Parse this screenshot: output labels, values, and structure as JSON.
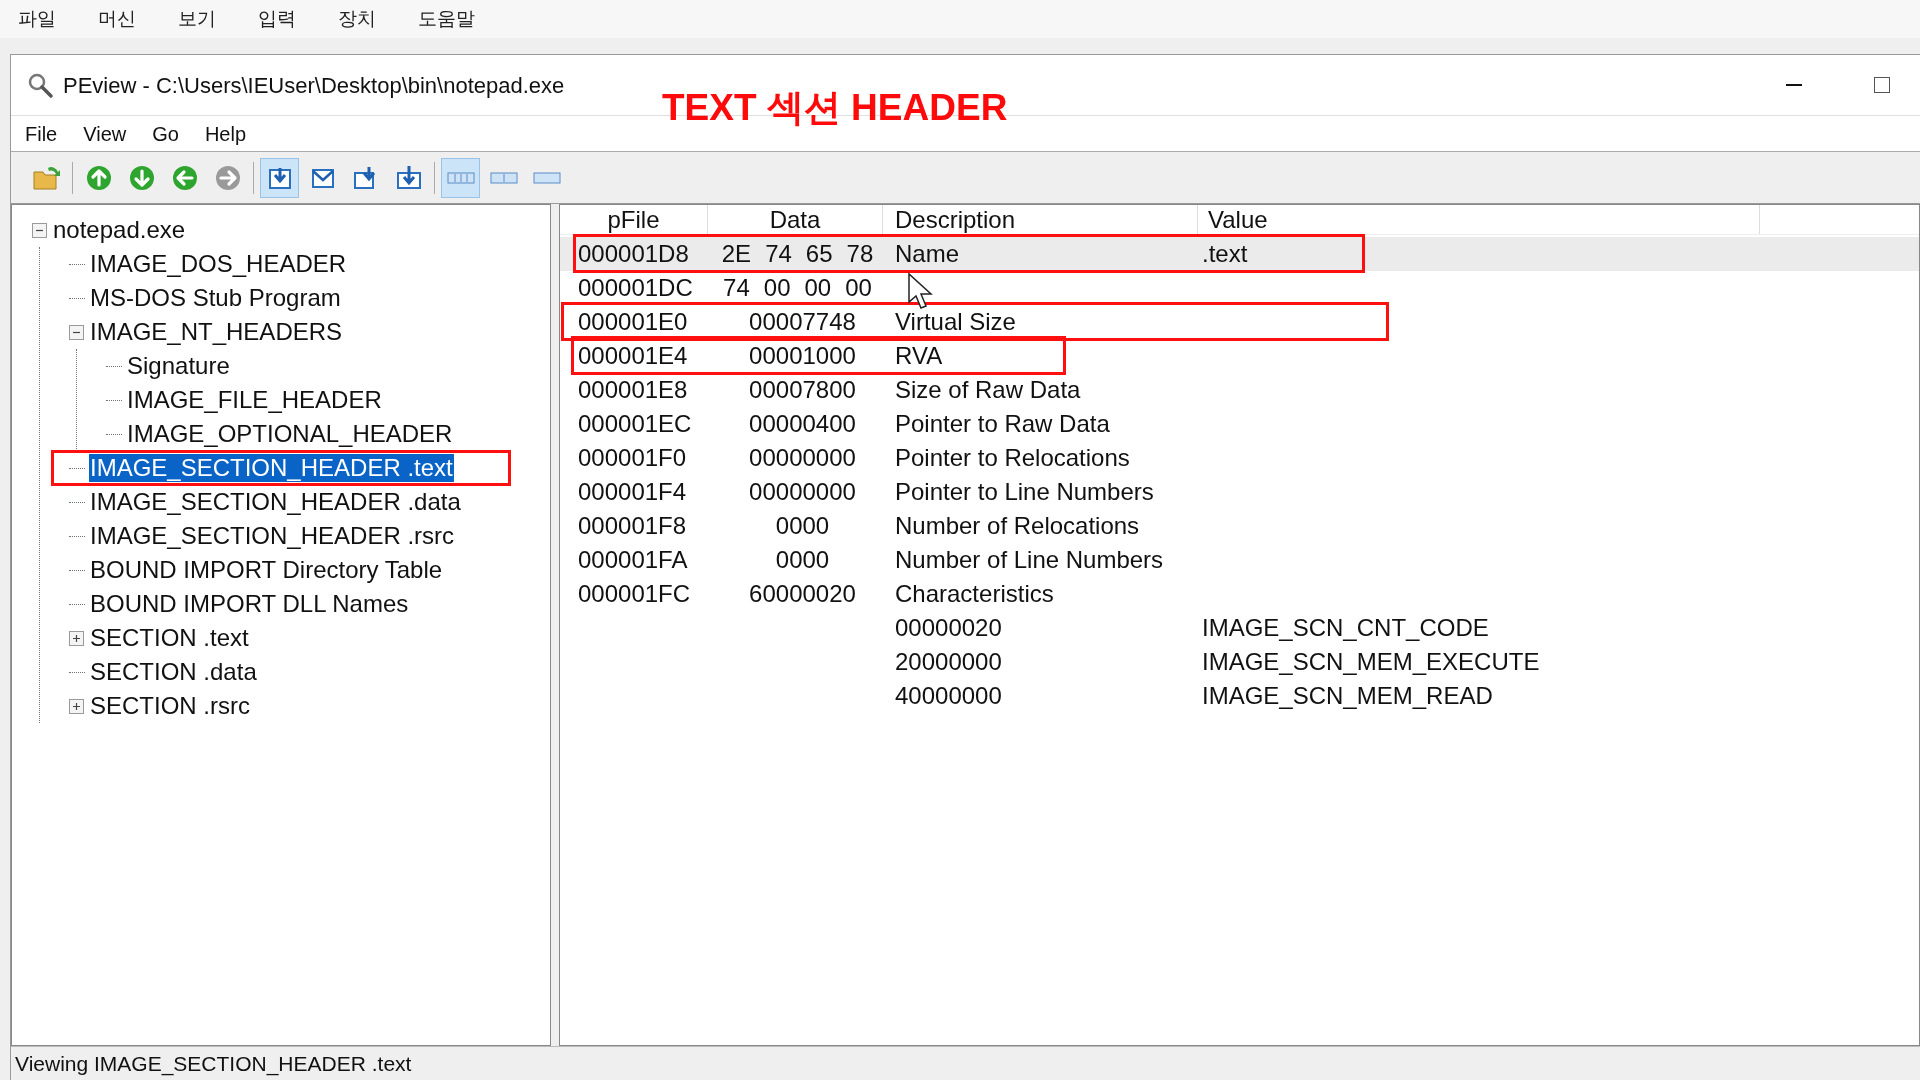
{
  "host_menu": [
    "파일",
    "머신",
    "보기",
    "입력",
    "장치",
    "도움말"
  ],
  "window": {
    "title": "PEview - C:\\Users\\IEUser\\Desktop\\bin\\notepad.exe"
  },
  "annotation": {
    "text": "TEXT 섹션 HEADER"
  },
  "menu": [
    "File",
    "View",
    "Go",
    "Help"
  ],
  "toolbar": [
    [
      {
        "kind": "open",
        "selected": false
      }
    ],
    [
      {
        "kind": "up",
        "disabled": false,
        "selected": false
      },
      {
        "kind": "down",
        "disabled": false,
        "selected": false
      },
      {
        "kind": "back",
        "disabled": false,
        "selected": false
      },
      {
        "kind": "forward",
        "disabled": true,
        "selected": false
      }
    ],
    [
      {
        "kind": "view-a",
        "selected": true
      },
      {
        "kind": "view-b",
        "selected": false
      },
      {
        "kind": "view-c",
        "selected": false
      },
      {
        "kind": "view-d",
        "selected": false
      }
    ],
    [
      {
        "kind": "cols-3",
        "selected": true
      },
      {
        "kind": "cols-2",
        "selected": false
      },
      {
        "kind": "cols-1",
        "selected": false
      }
    ]
  ],
  "tree": [
    {
      "label": "notepad.exe",
      "expanded": true,
      "selected": false,
      "children": [
        {
          "label": "IMAGE_DOS_HEADER",
          "selected": false
        },
        {
          "label": "MS-DOS Stub Program",
          "selected": false
        },
        {
          "label": "IMAGE_NT_HEADERS",
          "expanded": true,
          "selected": false,
          "children": [
            {
              "label": "Signature",
              "selected": false
            },
            {
              "label": "IMAGE_FILE_HEADER",
              "selected": false
            },
            {
              "label": "IMAGE_OPTIONAL_HEADER",
              "selected": false
            }
          ]
        },
        {
          "label": "IMAGE_SECTION_HEADER .text",
          "selected": true,
          "annotation": {
            "kind": "box"
          }
        },
        {
          "label": "IMAGE_SECTION_HEADER .data",
          "selected": false
        },
        {
          "label": "IMAGE_SECTION_HEADER .rsrc",
          "selected": false
        },
        {
          "label": "BOUND IMPORT Directory Table",
          "selected": false
        },
        {
          "label": "BOUND IMPORT DLL Names",
          "selected": false
        },
        {
          "label": "SECTION .text",
          "expanded": false,
          "selected": false
        },
        {
          "label": "SECTION .data",
          "selected": false
        },
        {
          "label": "SECTION .rsrc",
          "expanded": false,
          "selected": false
        }
      ]
    }
  ],
  "table": {
    "columns": [
      "pFile",
      "Data",
      "Description",
      "Value"
    ],
    "rows": [
      {
        "pfile": "000001D8",
        "bytes": [
          "2E",
          "74",
          "65",
          "78"
        ],
        "description": "Name",
        "value": ".text",
        "selected": true,
        "annotation": {
          "kind": "through-value"
        }
      },
      {
        "pfile": "000001DC",
        "bytes": [
          "74",
          "00",
          "00",
          "00"
        ],
        "selected": false
      },
      {
        "pfile": "000001E0",
        "data": "00007748",
        "description": "Virtual Size",
        "selected": false,
        "annotation": {
          "kind": "wide"
        }
      },
      {
        "pfile": "000001E4",
        "data": "00001000",
        "description": "RVA",
        "selected": false,
        "annotation": {
          "kind": "through-description"
        }
      },
      {
        "pfile": "000001E8",
        "data": "00007800",
        "description": "Size of Raw Data",
        "selected": false
      },
      {
        "pfile": "000001EC",
        "data": "00000400",
        "description": "Pointer to Raw Data",
        "selected": false
      },
      {
        "pfile": "000001F0",
        "data": "00000000",
        "description": "Pointer to Relocations",
        "selected": false
      },
      {
        "pfile": "000001F4",
        "data": "00000000",
        "description": "Pointer to Line Numbers",
        "selected": false
      },
      {
        "pfile": "000001F8",
        "data": "0000",
        "description": "Number of Relocations",
        "selected": false
      },
      {
        "pfile": "000001FA",
        "data": "0000",
        "description": "Number of Line Numbers",
        "selected": false
      },
      {
        "pfile": "000001FC",
        "data": "60000020",
        "description": "Characteristics",
        "selected": false
      },
      {
        "description": "00000020",
        "value": "IMAGE_SCN_CNT_CODE",
        "selected": false
      },
      {
        "description": "20000000",
        "value": "IMAGE_SCN_MEM_EXECUTE",
        "selected": false
      },
      {
        "description": "40000000",
        "value": "IMAGE_SCN_MEM_READ",
        "selected": false
      }
    ]
  },
  "status_bar": "Viewing IMAGE_SECTION_HEADER .text"
}
